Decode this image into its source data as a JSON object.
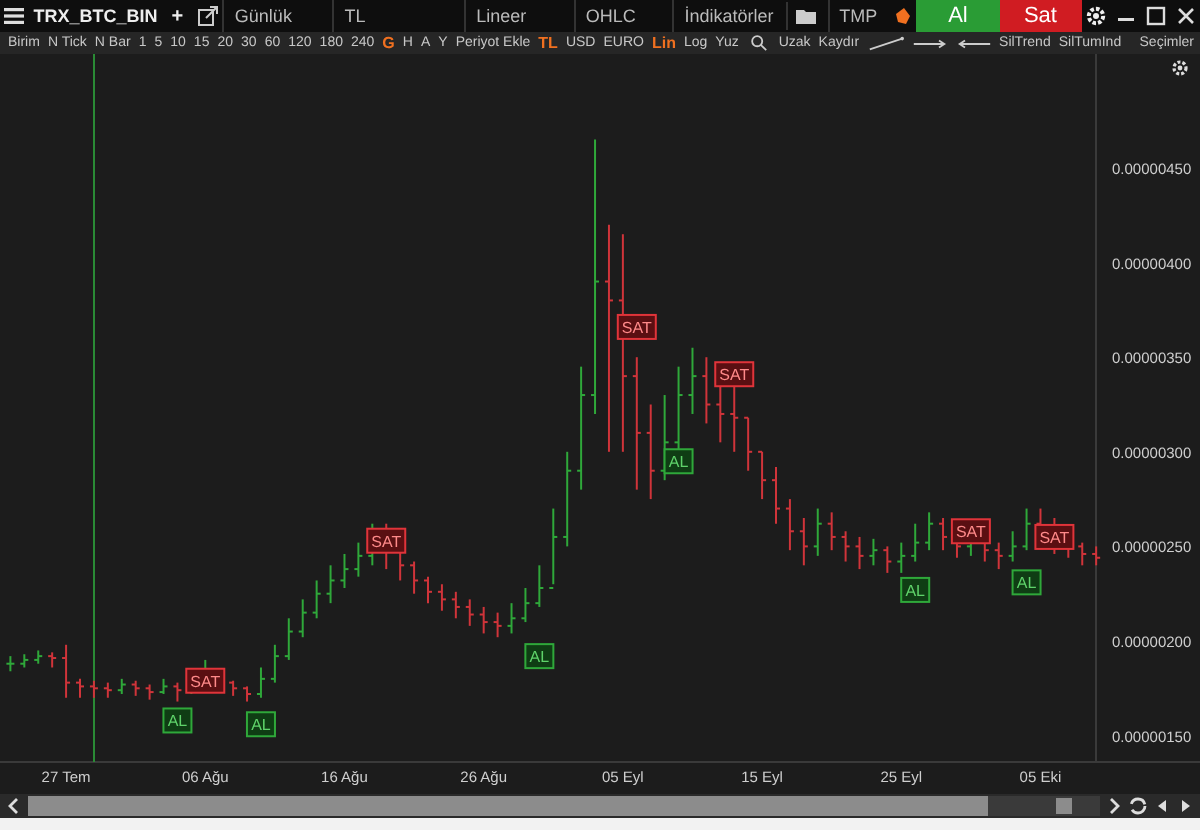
{
  "toolbar": {
    "symbol": "TRX_BTC_BIN",
    "add": "+",
    "period": "Günlük",
    "currency_field": "TL",
    "scale": "Lineer",
    "style": "OHLC",
    "indicators": "İndikatörler",
    "template": "TMP",
    "buy_button": "Al",
    "sell_button": "Sat"
  },
  "options_bar": {
    "groups": [
      [
        {
          "label": "Birim",
          "selected": false
        },
        {
          "label": "N Tick",
          "selected": false
        },
        {
          "label": "N Bar",
          "selected": false
        },
        {
          "label": "1",
          "selected": false
        },
        {
          "label": "5",
          "selected": false
        },
        {
          "label": "10",
          "selected": false
        },
        {
          "label": "15",
          "selected": false
        },
        {
          "label": "20",
          "selected": false
        },
        {
          "label": "30",
          "selected": false
        },
        {
          "label": "60",
          "selected": false
        },
        {
          "label": "120",
          "selected": false
        },
        {
          "label": "180",
          "selected": false
        },
        {
          "label": "240",
          "selected": false
        },
        {
          "label": "G",
          "selected": true
        },
        {
          "label": "H",
          "selected": false
        },
        {
          "label": "A",
          "selected": false
        },
        {
          "label": "Y",
          "selected": false
        },
        {
          "label": "Periyot Ekle",
          "selected": false
        }
      ],
      [
        {
          "label": "TL",
          "selected": true
        },
        {
          "label": "USD",
          "selected": false
        },
        {
          "label": "EURO",
          "selected": false
        }
      ],
      [
        {
          "label": "Lin",
          "selected": true
        },
        {
          "label": "Log",
          "selected": false
        },
        {
          "label": "Yuz",
          "selected": false
        }
      ],
      [
        {
          "label": "Uzak",
          "selected": false
        },
        {
          "label": "Kaydır",
          "selected": false
        }
      ],
      [
        {
          "label": "SilTrend",
          "selected": false
        },
        {
          "label": "SilTumInd",
          "selected": false
        }
      ]
    ],
    "selections": "Seçimler"
  },
  "chart": {
    "price_axis": [
      "0.00000450",
      "0.00000400",
      "0.00000350",
      "0.00000300",
      "0.00000250",
      "0.00000200",
      "0.00000150"
    ],
    "date_axis": [
      "27 Tem",
      "06 Ağu",
      "16 Ağu",
      "26 Ağu",
      "05 Eyl",
      "15 Eyl",
      "25 Eyl",
      "05 Eki"
    ],
    "signals": [
      {
        "kind": "buy",
        "label": "AL"
      },
      {
        "kind": "sell",
        "label": "SAT"
      },
      {
        "kind": "buy",
        "label": "AL"
      },
      {
        "kind": "sell",
        "label": "SAT"
      },
      {
        "kind": "buy",
        "label": "AL"
      },
      {
        "kind": "sell",
        "label": "SAT"
      },
      {
        "kind": "buy",
        "label": "AL"
      },
      {
        "kind": "sell",
        "label": "SAT"
      },
      {
        "kind": "buy",
        "label": "AL"
      },
      {
        "kind": "sell",
        "label": "SAT"
      },
      {
        "kind": "buy",
        "label": "AL"
      },
      {
        "kind": "sell",
        "label": "SAT"
      }
    ]
  }
}
